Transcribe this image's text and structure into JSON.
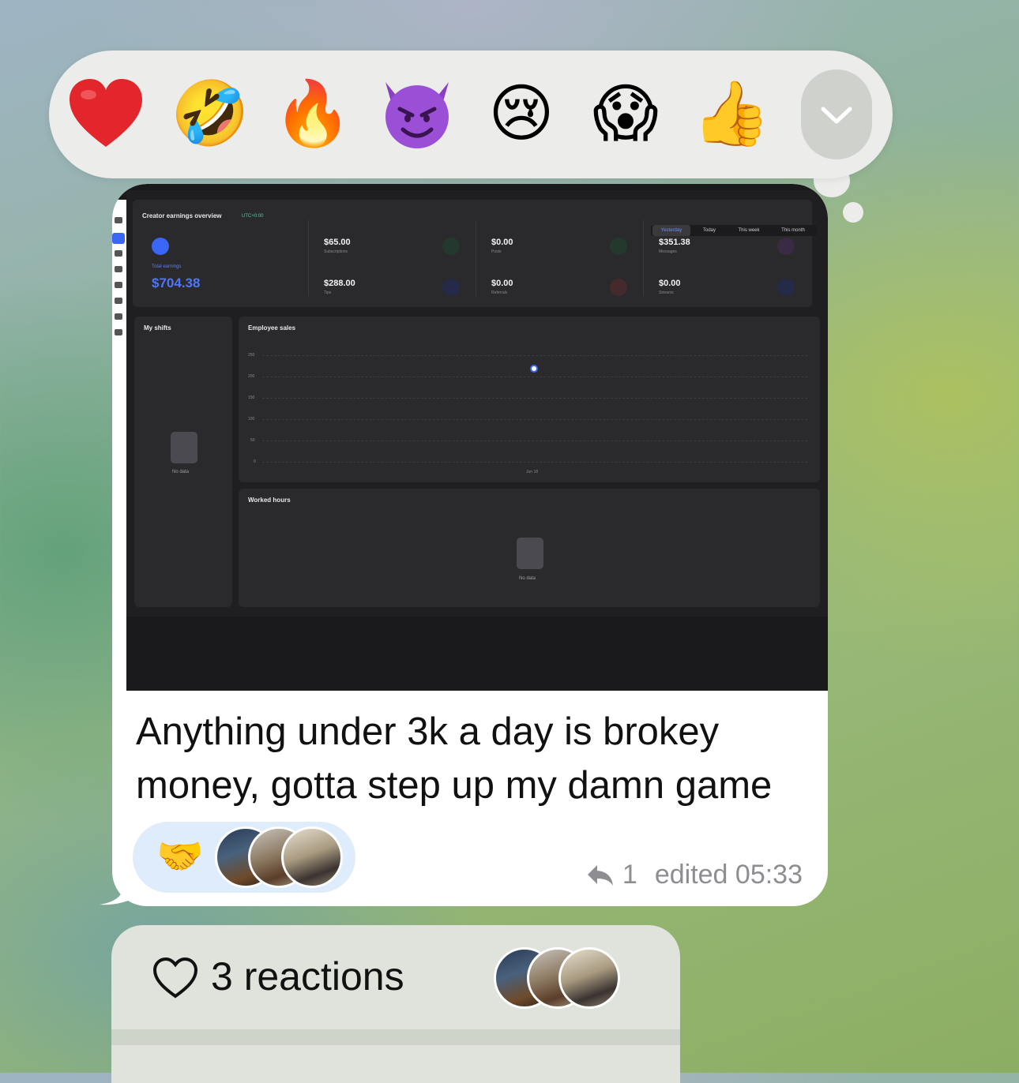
{
  "picker": {
    "emojis": [
      "red-heart",
      "rolling-on-floor-laughing",
      "fire",
      "smiling-face-with-horns",
      "crying-face",
      "face-screaming-in-fear",
      "thumbs-up"
    ],
    "glyphs": {
      "fire": "🔥",
      "thumbs": "👍",
      "crying": "😢",
      "laughing": "🤣",
      "scream": "😱"
    }
  },
  "dashboard": {
    "title": "Creator earnings overview",
    "timezone": "UTC+0:00",
    "tabs": [
      "Yesterday",
      "Today",
      "This week",
      "This month"
    ],
    "total_label": "Total earnings",
    "total_value": "$704.38",
    "stats": [
      {
        "value": "$65.00",
        "label": "Subscriptions"
      },
      {
        "value": "$0.00",
        "label": "Posts"
      },
      {
        "value": "$351.38",
        "label": "Messages"
      },
      {
        "value": "$288.00",
        "label": "Tips"
      },
      {
        "value": "$0.00",
        "label": "Referrals"
      },
      {
        "value": "$0.00",
        "label": "Streams"
      }
    ],
    "my_shifts": "My shifts",
    "employee_sales": "Employee sales",
    "worked_hours": "Worked hours",
    "no_data": "No data",
    "y_ticks": [
      "250",
      "200",
      "150",
      "100",
      "50",
      "0"
    ],
    "x_tick": "Jun 18"
  },
  "message": {
    "text": "Anything under 3k a day is brokey money, gotta step up my damn game",
    "reaction_emoji": "🤝",
    "replies": "1",
    "edited": "edited 05:33"
  },
  "reactions_panel": {
    "label": "3 reactions"
  },
  "colors": {
    "accent_blue": "#3b66f5",
    "bubble": "#ffffff",
    "reaction_pill": "#dfecfb"
  }
}
